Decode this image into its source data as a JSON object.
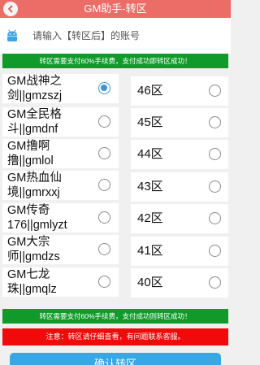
{
  "header": {
    "title": "GM助手-转区"
  },
  "account": {
    "placeholder": "请输入【转区后】的账号"
  },
  "notices": {
    "fee_top": "转区需要支付60%手续费，支付成功即转区成功！",
    "fee_bottom": "转区需要支付60%手续费，支付成功则转区成功！",
    "warning": "注意：转区请仔细查看，有问题联系客服。"
  },
  "source_zones": [
    {
      "label": "GM战神之剑||gmzszj",
      "checked": true
    },
    {
      "label": "GM全民格斗||gmdnf",
      "checked": false
    },
    {
      "label": "GM撸啊撸||gmlol",
      "checked": false
    },
    {
      "label": "GM热血仙境||gmrxxj",
      "checked": false
    },
    {
      "label": "GM传奇176||gmlyzt",
      "checked": false
    },
    {
      "label": "GM大宗师||gmdzs",
      "checked": false
    },
    {
      "label": "GM七龙珠||gmqlz",
      "checked": false
    }
  ],
  "target_zones": [
    {
      "label": "46区",
      "checked": false
    },
    {
      "label": "45区",
      "checked": false
    },
    {
      "label": "44区",
      "checked": false
    },
    {
      "label": "43区",
      "checked": false
    },
    {
      "label": "42区",
      "checked": false
    },
    {
      "label": "41区",
      "checked": false
    },
    {
      "label": "40区",
      "checked": false
    }
  ],
  "actions": {
    "confirm_label": "确认转区"
  },
  "colors": {
    "header": "#ec6d68",
    "notice_green": "#0f9a2a",
    "warning_red": "#f00a0a",
    "button_blue": "#39a7e3",
    "radio_checked": "#3d93d6"
  }
}
